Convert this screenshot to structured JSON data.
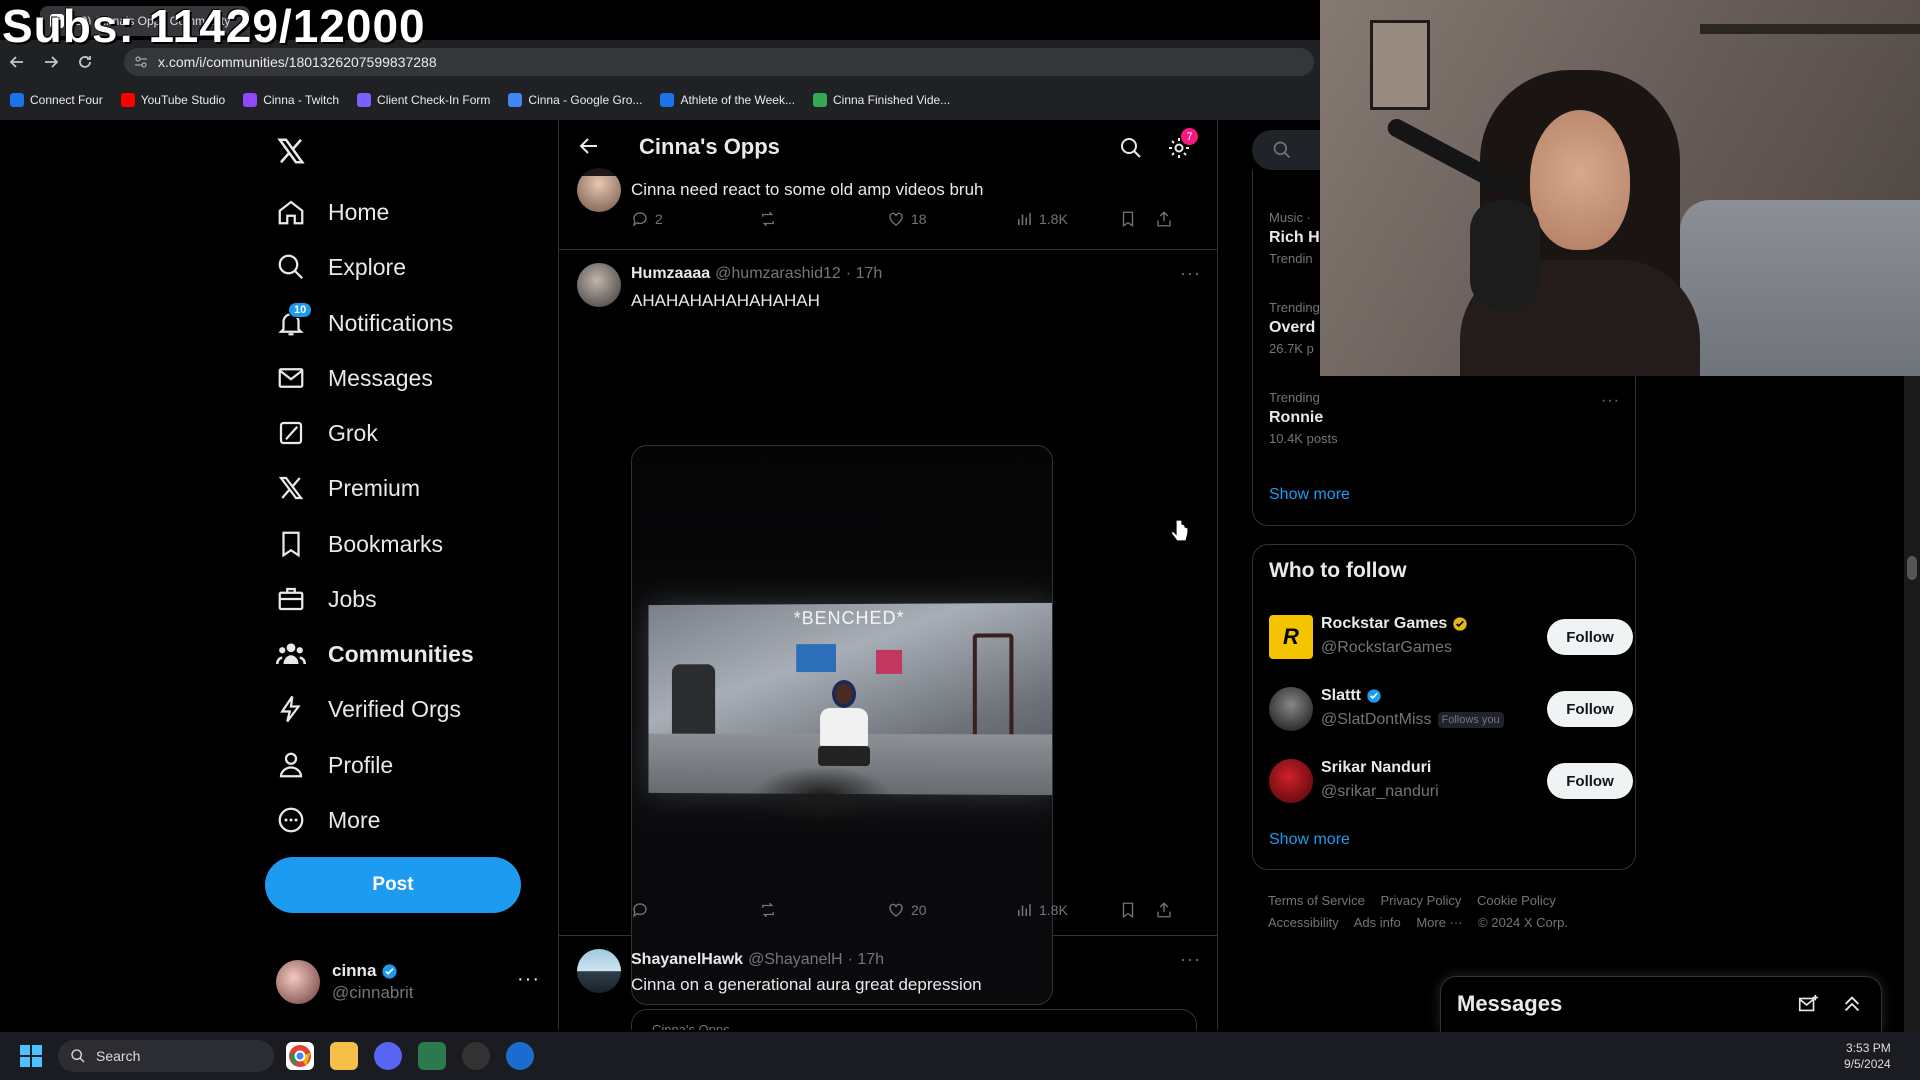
{
  "overlay": {
    "subs_text": "Subs: 11429/12000"
  },
  "browser": {
    "tab_title": "(10) Cinna's Opps Community",
    "url": "x.com/i/communities/1801326207599837288",
    "bookmarks": [
      {
        "label": "Connect Four",
        "color": "#1a73e8"
      },
      {
        "label": "YouTube Studio",
        "color": "#ff0000"
      },
      {
        "label": "Cinna - Twitch",
        "color": "#9146ff"
      },
      {
        "label": "Client Check-In Form",
        "color": "#7b61ff"
      },
      {
        "label": "Cinna - Google Gro...",
        "color": "#4285f4"
      },
      {
        "label": "Athlete of the Week...",
        "color": "#1a73e8"
      },
      {
        "label": "Cinna Finished Vide...",
        "color": "#34a853"
      }
    ]
  },
  "nav": {
    "items": [
      {
        "label": "Home",
        "icon": "home-icon"
      },
      {
        "label": "Explore",
        "icon": "search-icon"
      },
      {
        "label": "Notifications",
        "icon": "bell-icon",
        "badge": "10"
      },
      {
        "label": "Messages",
        "icon": "envelope-icon"
      },
      {
        "label": "Grok",
        "icon": "grok-icon"
      },
      {
        "label": "Premium",
        "icon": "x-icon"
      },
      {
        "label": "Bookmarks",
        "icon": "bookmark-icon"
      },
      {
        "label": "Jobs",
        "icon": "briefcase-icon"
      },
      {
        "label": "Communities",
        "icon": "people-icon"
      },
      {
        "label": "Verified Orgs",
        "icon": "lightning-icon"
      },
      {
        "label": "Profile",
        "icon": "person-icon"
      },
      {
        "label": "More",
        "icon": "more-circle-icon"
      }
    ],
    "post_label": "Post",
    "account": {
      "name": "cinna",
      "handle": "@cinnabrit"
    }
  },
  "feed": {
    "title": "Cinna's Opps",
    "settings_badge": "7",
    "tweets": [
      {
        "text": "Cinna need react to some old amp videos bruh",
        "replies": "2",
        "retweets": "",
        "likes": "18",
        "views": "1.8K"
      },
      {
        "name": "Humzaaaa",
        "handle": "@humzarashid12",
        "time": "· 17h",
        "text": "AHAHAHAHAHAHAHAH",
        "media_caption": "*BENCHED*",
        "replies": "",
        "retweets": "",
        "likes": "20",
        "views": "1.8K"
      },
      {
        "name": "ShayanelHawk",
        "handle": "@ShayanelH",
        "time": "· 17h",
        "text": "Cinna on a generational aura great depression",
        "quote_label": "Cinna's Opps"
      }
    ]
  },
  "sidebar": {
    "trends": [
      {
        "category": "Music ·",
        "topic": "Rich H",
        "count": "Trendin"
      },
      {
        "category": "Trending",
        "topic": "Overd",
        "count": "26.7K p"
      },
      {
        "category": "Trending",
        "topic": "Ronnie",
        "count": "10.4K posts"
      }
    ],
    "show_more": "Show more",
    "who_to_follow": {
      "title": "Who to follow",
      "accounts": [
        {
          "name": "Rockstar Games",
          "handle": "@RockstarGames",
          "verified": "gold",
          "follows_you": ""
        },
        {
          "name": "Slattt",
          "handle": "@SlatDontMiss",
          "verified": "blue",
          "follows_you": "Follows you"
        },
        {
          "name": "Srikar Nanduri",
          "handle": "@srikar_nanduri",
          "verified": "",
          "follows_you": ""
        }
      ],
      "follow_label": "Follow",
      "show_more": "Show more"
    },
    "footer": [
      "Terms of Service",
      "Privacy Policy",
      "Cookie Policy",
      "Accessibility",
      "Ads info",
      "More ···",
      "© 2024 X Corp."
    ],
    "messages_title": "Messages"
  },
  "taskbar": {
    "search_label": "Search",
    "time": "3:53 PM",
    "date": "9/5/2024"
  },
  "colors": {
    "accent": "#1d9bf0",
    "bg": "#000000",
    "border": "#2f3336",
    "muted": "#71767b"
  }
}
